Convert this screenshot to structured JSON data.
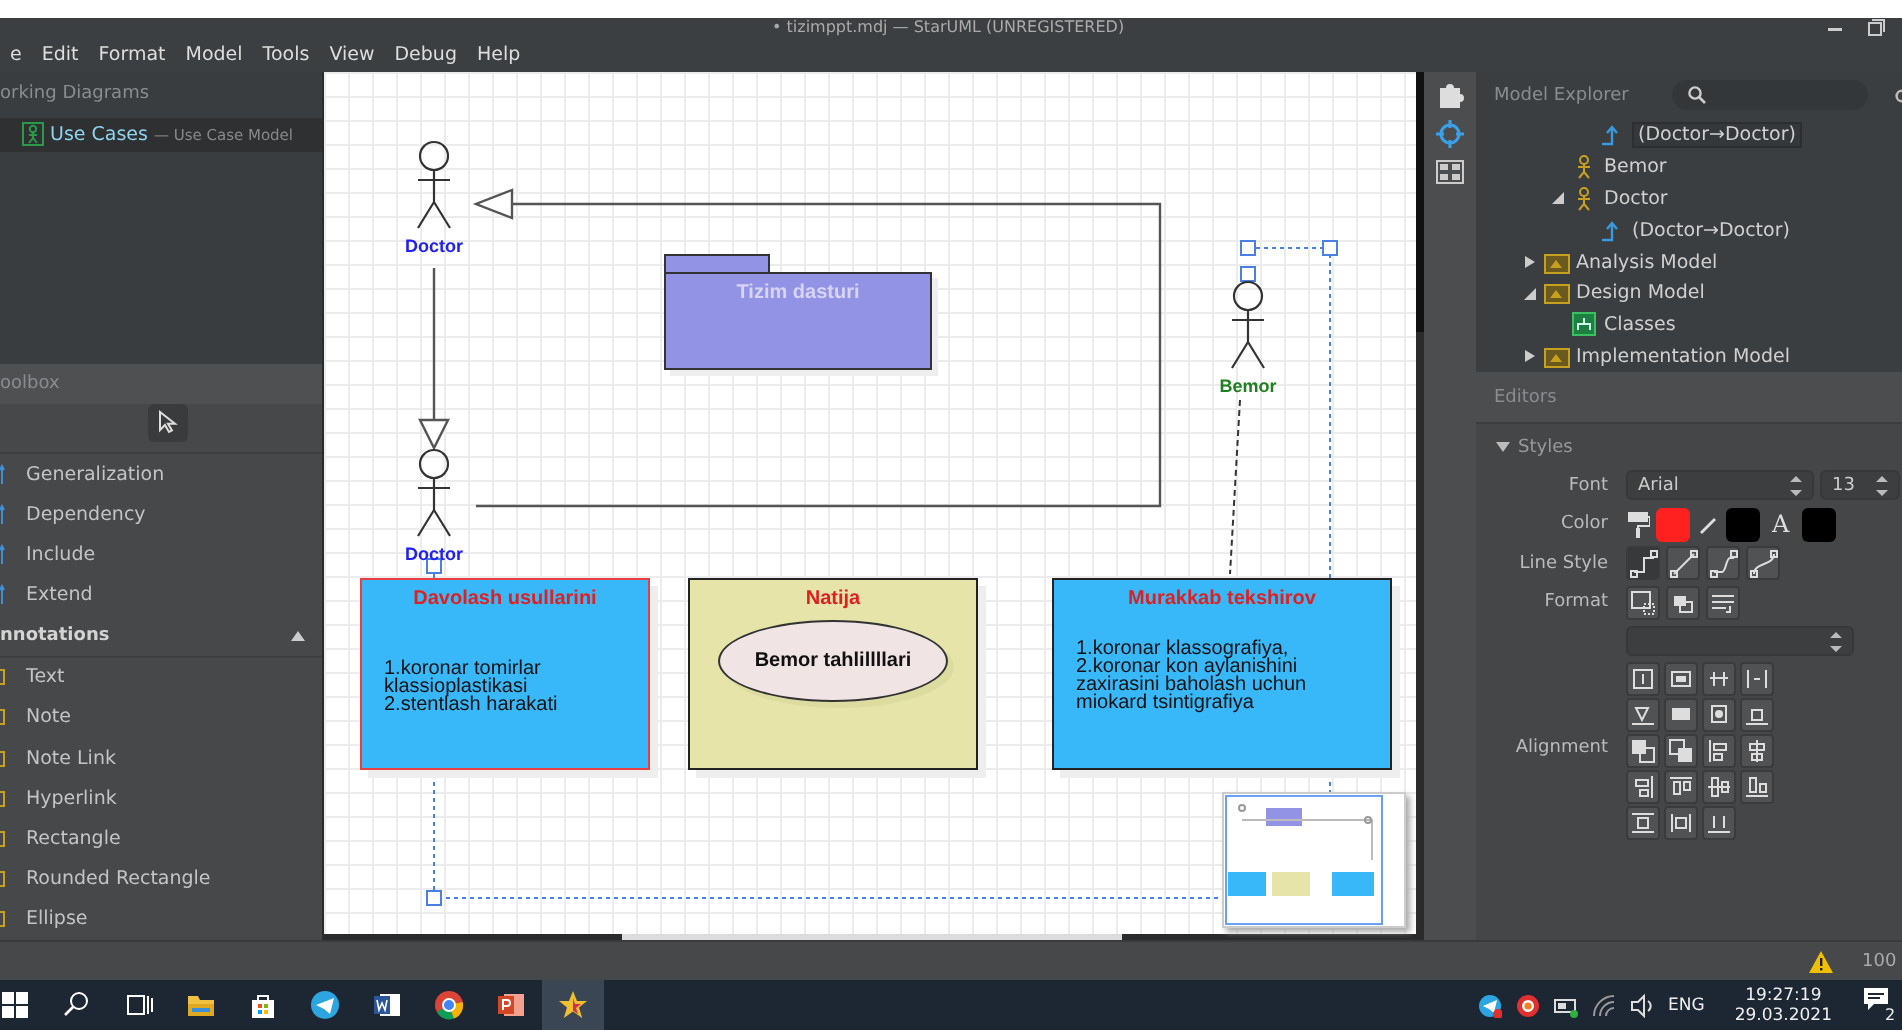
{
  "window": {
    "title": "• tizimppt.mdj — StarUML (UNREGISTERED)"
  },
  "menu": [
    "e",
    "Edit",
    "Format",
    "Model",
    "Tools",
    "View",
    "Debug",
    "Help"
  ],
  "working_diagrams": {
    "header": "orking Diagrams",
    "items": [
      {
        "name": "Use Cases",
        "detail": "— Use Case Model",
        "selected": true
      }
    ]
  },
  "toolbox": {
    "header": "oolbox",
    "groups": [
      {
        "kind": "relation",
        "items": [
          "Generalization",
          "Dependency",
          "Include",
          "Extend"
        ]
      },
      {
        "kind": "annotation",
        "title": "nnotations",
        "expanded": true,
        "items": [
          "Text",
          "Note",
          "Note Link",
          "Hyperlink",
          "Rectangle",
          "Rounded Rectangle",
          "Ellipse"
        ]
      }
    ]
  },
  "diagram": {
    "actors": [
      {
        "name": "Doctor",
        "color": "#2020f0"
      },
      {
        "name": "Doctor",
        "color": "#2020f0"
      },
      {
        "name": "Bemor",
        "color": "#208020"
      }
    ],
    "package": {
      "name": "Tizim dasturi"
    },
    "boxes": [
      {
        "title": "Davolash usullarini",
        "text": "1.koronar tomirlar\nklassioplastikasi\n2.stentlash harakati",
        "color": "#38b8f8",
        "selected": true
      },
      {
        "title": "Natija",
        "color": "#e6e4a8",
        "selected": false,
        "ellipse": "Bemor tahlillllari"
      },
      {
        "title": "Murakkab tekshirov",
        "text": "1.koronar klassografiya,\n2.koronar kon aylanishini\nzaxirasini baholash uchun\nmiokard tsintigrafiya",
        "color": "#38b8f8",
        "selected": false
      }
    ]
  },
  "model_explorer": {
    "title": "Model Explorer",
    "items": [
      {
        "children": [
          {
            "children": [
              {
                "label": "(Doctor→Doctor)",
                "kind": "generalization",
                "selected": true
              }
            ]
          },
          {
            "label": "Bemor",
            "kind": "actor",
            "selected": false
          },
          {
            "label": "Doctor",
            "kind": "actor",
            "selected": false,
            "expanded": true,
            "children": [
              {
                "label": "(Doctor→Doctor)",
                "kind": "generalization",
                "selected": false
              }
            ]
          }
        ]
      },
      {
        "label": "Analysis Model",
        "kind": "model",
        "selected": false,
        "expanded": false
      },
      {
        "label": "Design Model",
        "kind": "model",
        "selected": false,
        "expanded": true,
        "children": [
          {
            "label": "Classes",
            "kind": "diagram",
            "selected": false
          }
        ]
      },
      {
        "label": "Implementation Model",
        "kind": "model",
        "selected": false,
        "expanded": false
      }
    ]
  },
  "editors": {
    "header": "Editors",
    "section": "Styles",
    "expanded": true,
    "font_label": "Font",
    "font": "Arial",
    "font_size": "13",
    "color_label": "Color",
    "color_swatches": [
      {
        "kind": "fill",
        "color": "#ff2020"
      },
      {
        "kind": "line",
        "color": "#000000"
      },
      {
        "kind": "font",
        "glyph": "A",
        "color": "#000000"
      }
    ],
    "line_style_label": "Line Style",
    "line_styles": [
      {
        "selected": true
      },
      {
        "selected": false
      },
      {
        "selected": false
      },
      {
        "selected": false
      }
    ],
    "format_label": "Format",
    "alignment_label": "Alignment"
  },
  "status_bar": {
    "zoom": "100"
  },
  "taskbar": {
    "language": "ENG",
    "time": "19:27:19",
    "date": "29.03.2021",
    "notifications": "2"
  }
}
